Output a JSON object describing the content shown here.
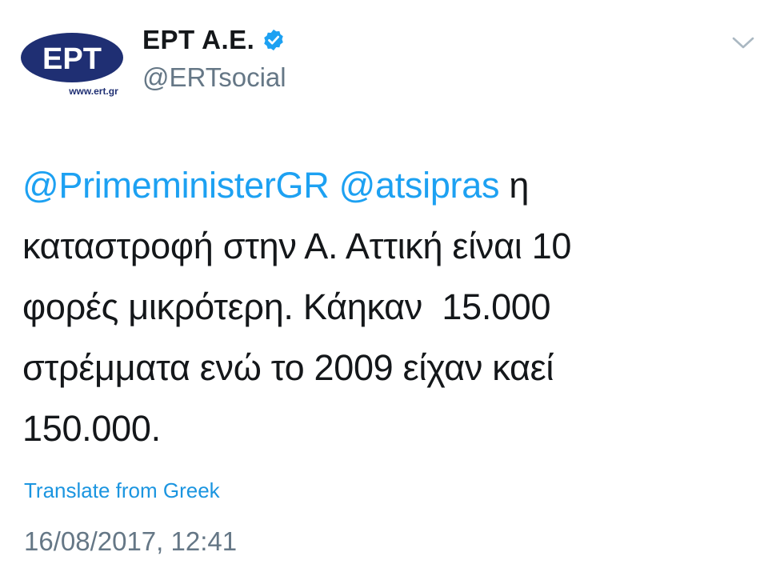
{
  "author": {
    "display_name": "ΕΡΤ Α.Ε.",
    "handle": "@ERTsocial",
    "verified": true,
    "avatar": {
      "logo_text": "ΕΡΤ",
      "logo_url_text": "www.ert.gr",
      "logo_color": "#1f2f73"
    }
  },
  "tweet": {
    "mention_1": "@PrimeministerGR",
    "mention_2": "@atsipras",
    "line_1_rest": " η",
    "line_2": "καταστροφή στην Α. Αττική είναι 10",
    "line_3": "φορές μικρότερη. Κάηκαν  15.000",
    "line_4": "στρέμματα ενώ το 2009 είχαν καεί",
    "line_5": "150.000."
  },
  "translate_label": "Translate from Greek",
  "timestamp": "16/08/2017, 12:41",
  "colors": {
    "link": "#1da1f2",
    "secondary_text": "#657786",
    "verified_badge": "#1da1f2"
  },
  "icons": {
    "verified": "verified-badge-icon",
    "caret": "chevron-down-icon"
  }
}
